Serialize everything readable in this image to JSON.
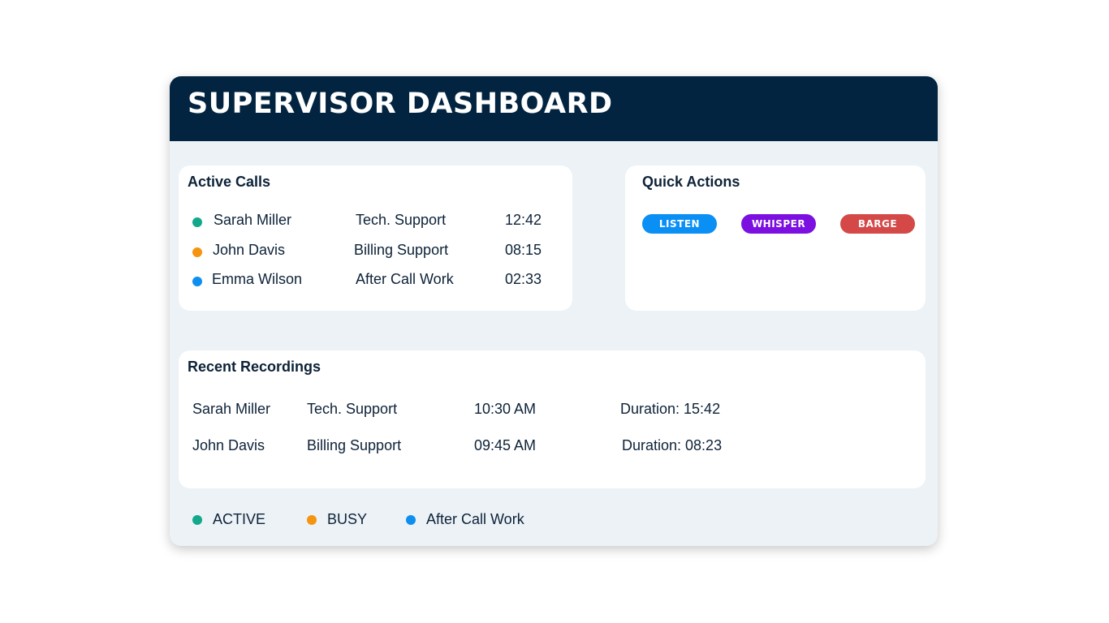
{
  "header": {
    "title": "SUPERVISOR DASHBOARD"
  },
  "colors": {
    "header_bg": "#022440",
    "active": "#12a88a",
    "busy": "#f5940f",
    "after_call_work": "#0e8ff0",
    "listen": "#0a8ff5",
    "whisper": "#7b10e0",
    "barge": "#d44848"
  },
  "active_calls": {
    "title": "Active Calls",
    "rows": [
      {
        "status": "active",
        "name": "Sarah Miller",
        "queue": "Tech. Support",
        "time": "12:42"
      },
      {
        "status": "busy",
        "name": "John Davis",
        "queue": "Billing Support",
        "time": "08:15"
      },
      {
        "status": "after_call_work",
        "name": "Emma Wilson",
        "queue": "After Call Work",
        "time": "02:33"
      }
    ]
  },
  "quick_actions": {
    "title": "Quick Actions",
    "buttons": [
      {
        "label": "LISTEN"
      },
      {
        "label": "WHISPER"
      },
      {
        "label": "BARGE"
      }
    ]
  },
  "recent_recordings": {
    "title": "Recent Recordings",
    "rows": [
      {
        "name": "Sarah Miller",
        "queue": "Tech. Support",
        "time": "10:30 AM",
        "duration": "Duration: 15:42"
      },
      {
        "name": "John Davis",
        "queue": "Billing Support",
        "time": "09:45 AM",
        "duration": "Duration: 08:23"
      }
    ]
  },
  "legend": [
    {
      "status": "active",
      "label": "ACTIVE"
    },
    {
      "status": "busy",
      "label": "BUSY"
    },
    {
      "status": "after_call_work",
      "label": "After Call Work"
    }
  ]
}
